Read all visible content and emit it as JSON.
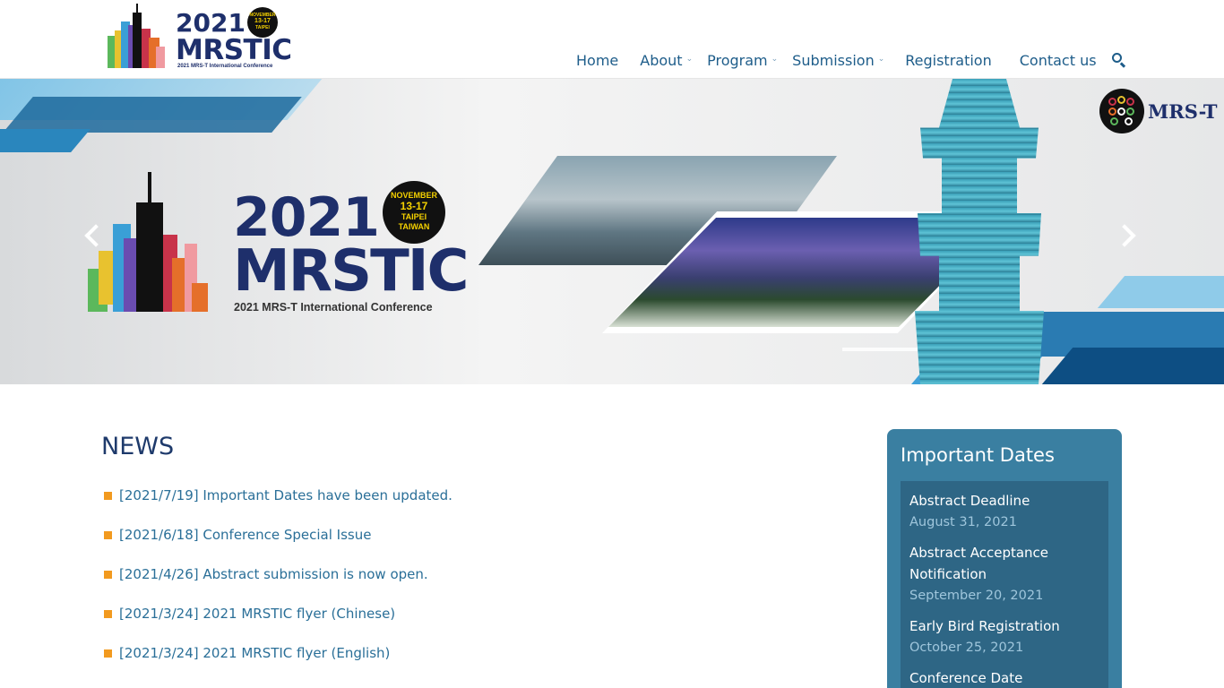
{
  "header": {
    "logo": {
      "year": "2021",
      "name": "MRSTIC",
      "subtitle": "2021 MRS-T International Conference",
      "badge_lines": [
        "NOVEMBER",
        "13-17",
        "TAIPEI",
        "TAIWAN"
      ]
    },
    "nav": [
      {
        "label": "Home",
        "has_dropdown": false
      },
      {
        "label": "About",
        "has_dropdown": true
      },
      {
        "label": "Program",
        "has_dropdown": true
      },
      {
        "label": "Submission",
        "has_dropdown": true
      },
      {
        "label": "Registration",
        "has_dropdown": false
      },
      {
        "label": "Contact us",
        "has_dropdown": false
      }
    ],
    "search_icon": "search-icon"
  },
  "banner": {
    "year": "2021",
    "name": "MRSTIC",
    "subtitle": "2021 MRS-T International Conference",
    "badge": {
      "month": "NOVEMBER",
      "dates": "13-17",
      "city": "TAIPEI",
      "country": "TAIWAN"
    },
    "partner_logo_text": "MRS-T",
    "prev_icon": "chevron-left-icon",
    "next_icon": "chevron-right-icon"
  },
  "news": {
    "title": "NEWS",
    "items": [
      "[2021/7/19] Important Dates have been updated.",
      "[2021/6/18] Conference Special Issue",
      "[2021/4/26] Abstract submission is now open.",
      "[2021/3/24] 2021 MRSTIC flyer (Chinese)",
      "[2021/3/24] 2021 MRSTIC flyer (English)"
    ]
  },
  "important_dates": {
    "title": "Important Dates",
    "entries": [
      {
        "label": "Abstract Deadline",
        "date": "August 31, 2021"
      },
      {
        "label": "Abstract Acceptance Notification",
        "date": "September 20, 2021"
      },
      {
        "label": "Early Bird Registration",
        "date": "October 25, 2021"
      },
      {
        "label": "Conference Date",
        "date": ""
      }
    ]
  },
  "colors": {
    "brand_navy": "#1e2f6b",
    "nav_link": "#1e5d8a",
    "news_link": "#2a6f98",
    "bullet": "#f29a1f",
    "dates_panel": "#3a7fa1",
    "dates_inner": "#2e6685"
  }
}
